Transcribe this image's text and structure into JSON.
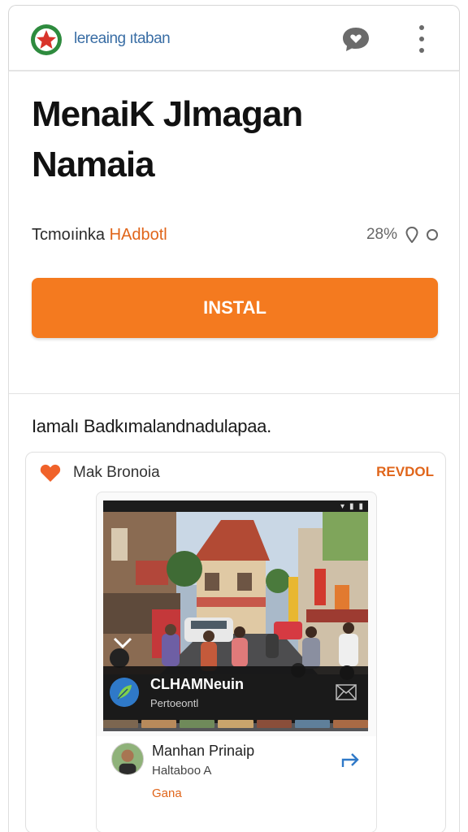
{
  "header": {
    "app_label": "lereaing ıtaban",
    "icons": [
      "star-badge-icon",
      "chat-heart-icon",
      "more-vert-icon"
    ]
  },
  "main": {
    "title_line1": "MenaiK Jlmagan",
    "title_line2": "Namaia",
    "meta_dark": "Tcmoıinka",
    "meta_accent": "HAdbotl",
    "meta_percent": "28%",
    "install_label": "INSTAL",
    "section_text": "Iamalı Badkımalandnadulapaa."
  },
  "card": {
    "name": "Mak Bronoia",
    "action": "REVDOL",
    "preview": {
      "overlay_title": "CLHAMNeuin",
      "overlay_sub": "Pertoeontl"
    },
    "profile": {
      "name": "Manhan Prinaip",
      "subtitle": "Haltaboo A",
      "link": "Gana"
    }
  },
  "colors": {
    "accent": "#f47a1f",
    "accent_text": "#e0651a",
    "brand_blue": "#3a6ea5"
  }
}
